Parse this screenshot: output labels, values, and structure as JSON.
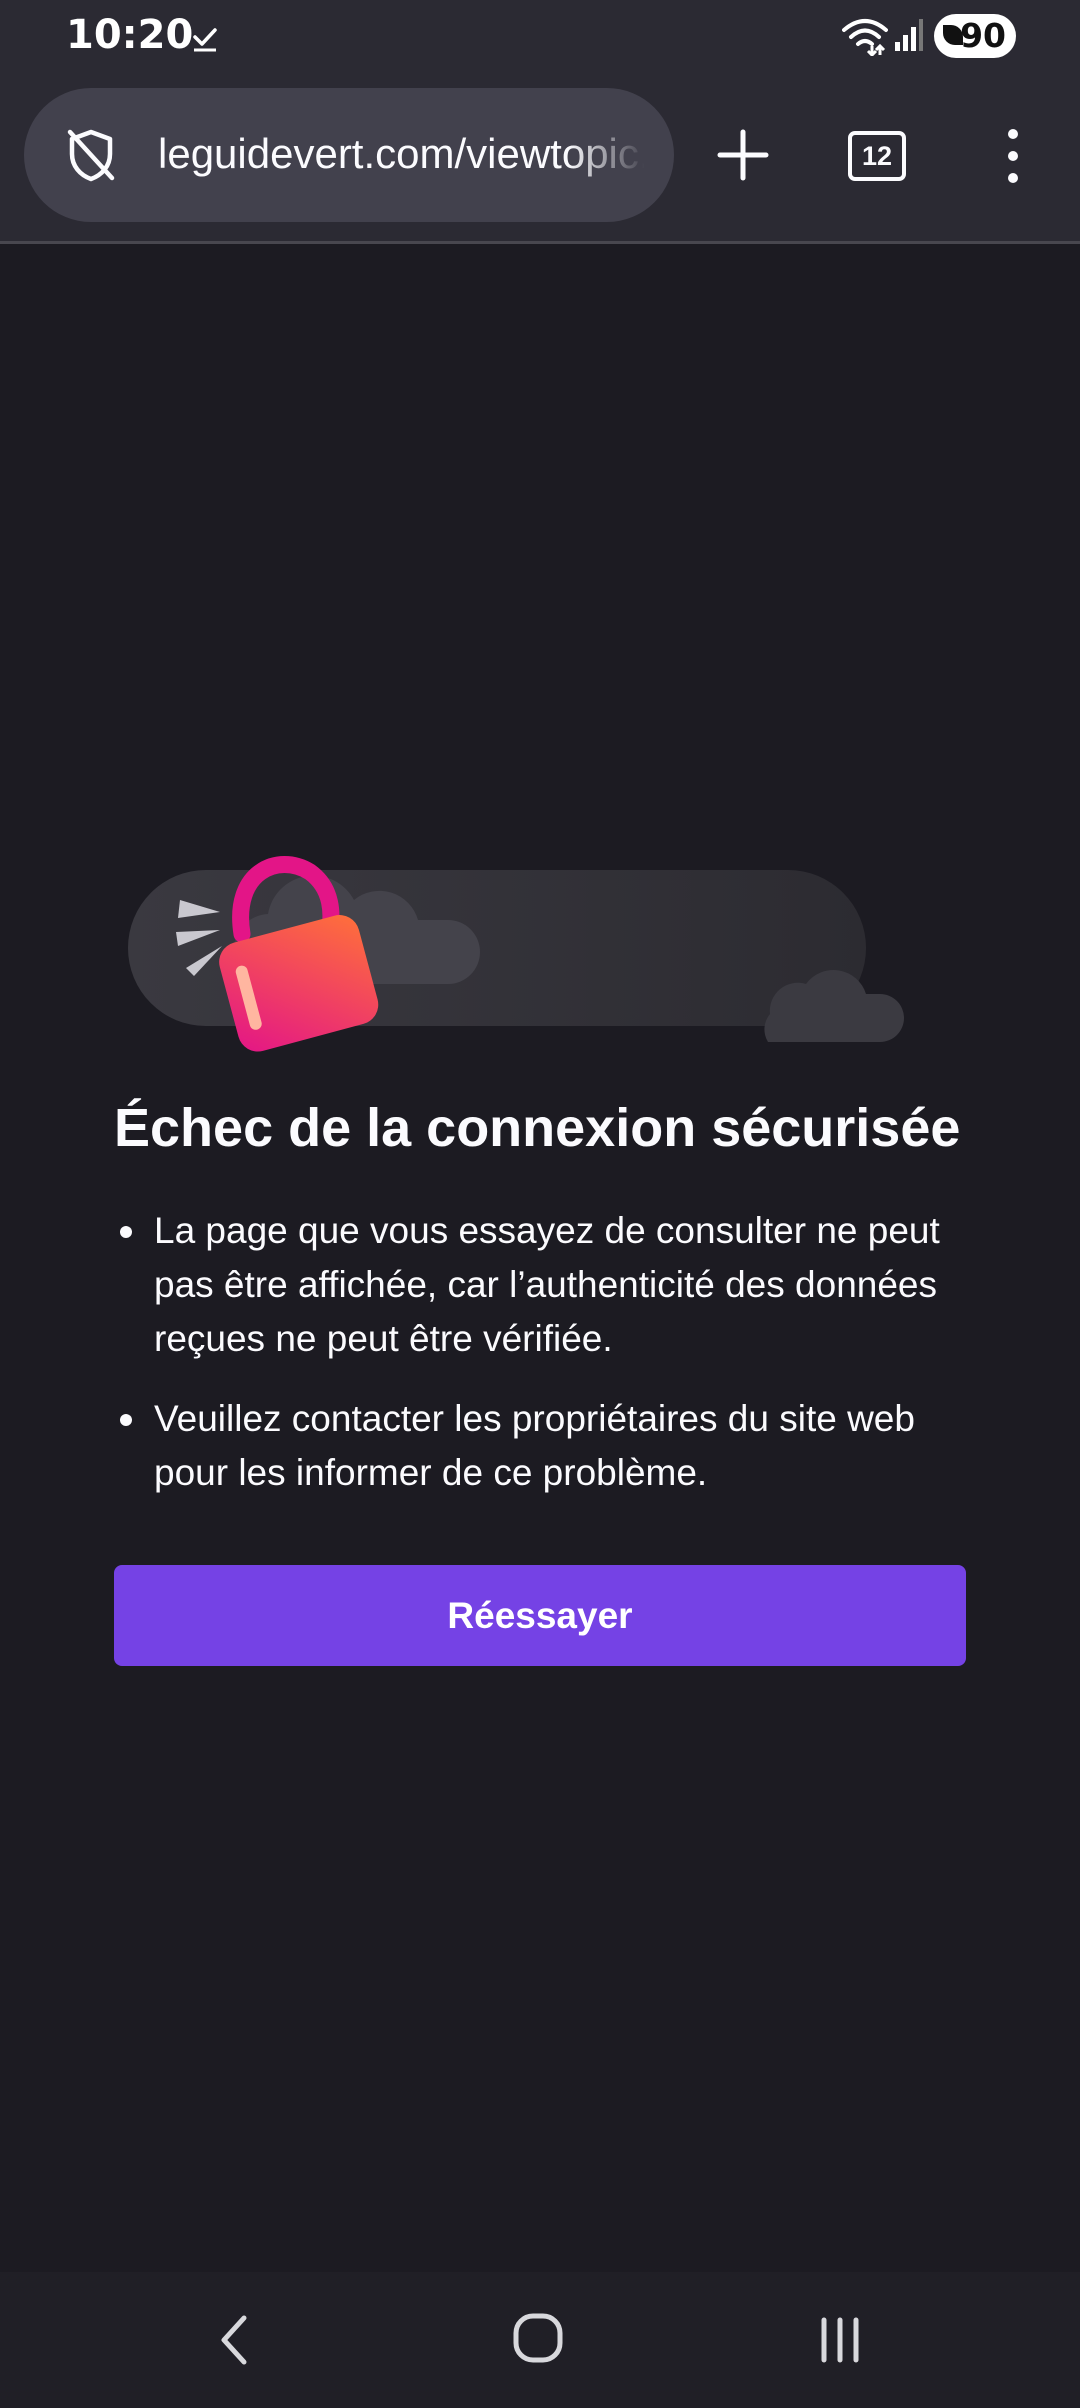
{
  "status_bar": {
    "time": "10:20",
    "battery_level": "90",
    "icons": [
      "check-icon",
      "wifi-icon",
      "signal-icon",
      "battery-icon"
    ]
  },
  "toolbar": {
    "url": "leguidevert.com/viewtopic.php",
    "tab_count": "12",
    "icons": [
      "shield-off-icon",
      "plus-icon",
      "tabs-icon",
      "more-vertical-icon"
    ]
  },
  "error": {
    "title": "Échec de la connexion sécurisée",
    "bullets": [
      "La page que vous essayez de consulter ne peut pas être affichée, car l’authenticité des données reçues ne peut être vérifiée.",
      "Veuillez contacter les propriétaires du site web pour les informer de ce problème."
    ],
    "retry_label": "Réessayer"
  },
  "colors": {
    "background": "#1c1b22",
    "toolbar": "#2b2a33",
    "url_bar": "#42414d",
    "accent": "#7542e5",
    "lock_gradient_start": "#ff4f5e",
    "lock_gradient_end": "#e31587"
  },
  "nav_bar": {
    "icons": [
      "back-icon",
      "home-icon",
      "recents-icon"
    ]
  }
}
